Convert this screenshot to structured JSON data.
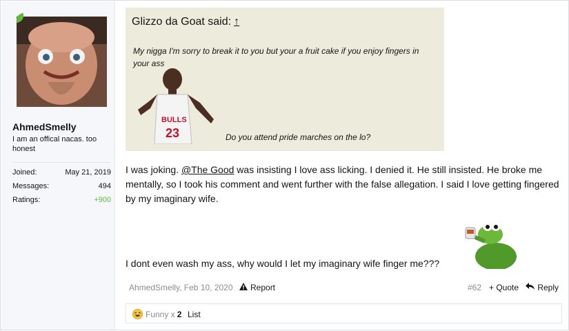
{
  "user": {
    "username": "AhmedSmelly",
    "title": "I am an offical nacas. too honest",
    "stats": [
      {
        "label": "Joined:",
        "value": "May 21, 2019"
      },
      {
        "label": "Messages:",
        "value": "494"
      },
      {
        "label": "Ratings:",
        "value": "+900"
      }
    ]
  },
  "quote": {
    "author_line": "Glizzo da Goat said:",
    "arrow": "↑",
    "text": "My nigga I'm sorry to break it to you but your a fruit cake if you enjoy fingers in your ass",
    "caption": "Do you attend pride marches on the lo?"
  },
  "message": {
    "para1_before": "I was joking. ",
    "mention": "@The Good",
    "para1_after": " was insisting I love ass licking. I denied it. He still insisted. He broke me mentally, so I took his comment and went further with the false allegation. I said I love getting fingered by my imaginary wife.",
    "para2": "I dont even wash my ass, why would I let my imaginary wife finger me???"
  },
  "footer": {
    "meta": "AhmedSmelly, Feb 10, 2020",
    "report": "Report",
    "post_number": "#62",
    "quote": "+ Quote",
    "reply": "Reply"
  },
  "reactions": {
    "label": "Funny x",
    "count": "2",
    "list": "List"
  }
}
